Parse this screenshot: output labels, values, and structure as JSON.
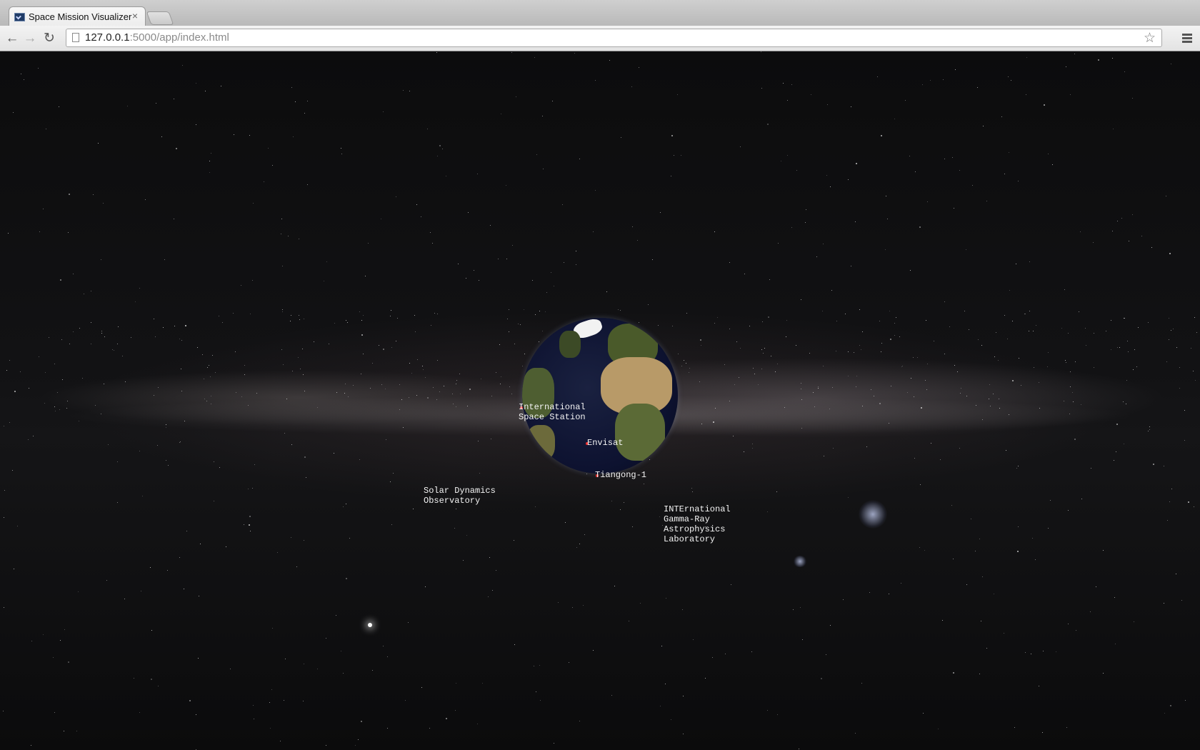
{
  "browser": {
    "tab_title": "Space Mission Visualizer",
    "tab_close": "×",
    "url_host": "127.0.0.1",
    "url_rest": ":5000/app/index.html",
    "icons": {
      "back": "arrow-left-icon",
      "forward": "arrow-right-icon",
      "reload": "reload-icon",
      "bookmark": "star-icon",
      "menu": "hamburger-menu-icon",
      "favicon": "terminal-icon"
    }
  },
  "scene": {
    "satellites": [
      {
        "label": "International\nSpace Station"
      },
      {
        "label": "Envisat"
      },
      {
        "label": "Tiangong-1"
      },
      {
        "label": "Solar Dynamics\nObservatory"
      },
      {
        "label": "INTErnational\nGamma-Ray\nAstrophysics\nLaboratory"
      }
    ],
    "colors": {
      "marker": "#ee3333",
      "label": "#f4f4f4",
      "ocean": "#0d1230"
    }
  }
}
